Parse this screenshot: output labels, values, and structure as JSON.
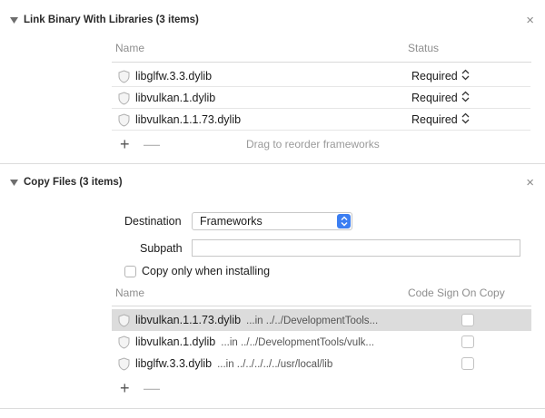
{
  "link_section": {
    "title": "Link Binary With Libraries (3 items)",
    "col_name": "Name",
    "col_status": "Status",
    "rows": [
      {
        "name": "libglfw.3.3.dylib",
        "status": "Required"
      },
      {
        "name": "libvulkan.1.dylib",
        "status": "Required"
      },
      {
        "name": "libvulkan.1.1.73.dylib",
        "status": "Required"
      }
    ],
    "add_label": "+",
    "remove_label": "—",
    "hint": "Drag to reorder frameworks",
    "close_label": "×"
  },
  "copy_section": {
    "title": "Copy Files (3 items)",
    "close_label": "×",
    "destination_label": "Destination",
    "destination_value": "Frameworks",
    "subpath_label": "Subpath",
    "subpath_value": "",
    "copy_only_label": "Copy only when installing",
    "copy_only_checked": false,
    "col_name": "Name",
    "col_codesign": "Code Sign On Copy",
    "rows": [
      {
        "name": "libvulkan.1.1.73.dylib",
        "path": "...in ../../DevelopmentTools...",
        "selected": true,
        "code_sign": false
      },
      {
        "name": "libvulkan.1.dylib",
        "path": "...in ../../DevelopmentTools/vulk...",
        "selected": false,
        "code_sign": false
      },
      {
        "name": "libglfw.3.3.dylib",
        "path": "...in ../../../../../usr/local/lib",
        "selected": false,
        "code_sign": false
      }
    ],
    "add_label": "+",
    "remove_label": "—"
  },
  "colors": {
    "accent": "#3b7ef2",
    "selected_row": "#dcdcdc"
  },
  "icons": {
    "disclosure": "disclosure-triangle-down-icon",
    "library": "library-shield-icon",
    "stepper": "up-down-stepper-icon"
  }
}
